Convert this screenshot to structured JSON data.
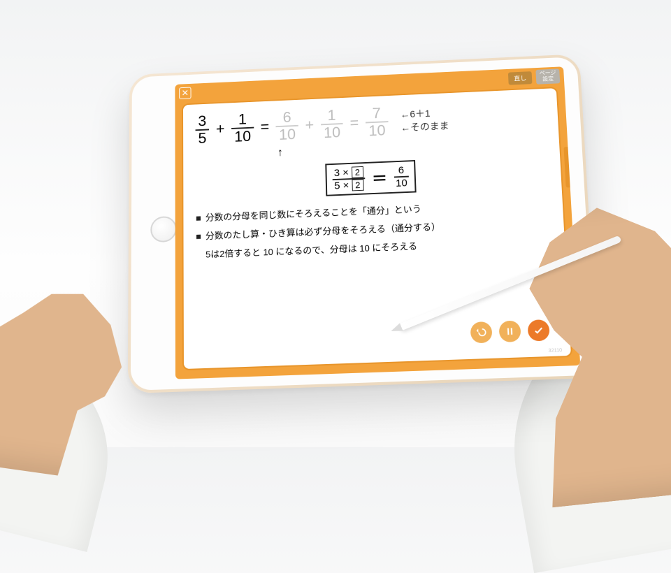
{
  "topbar": {
    "undo_label": "直し",
    "page_settings_label": "ページ\n設定"
  },
  "equation": {
    "f1": {
      "num": "3",
      "den": "5"
    },
    "plus1": "+",
    "f2": {
      "num": "1",
      "den": "10"
    },
    "eq1": "=",
    "f3": {
      "num": "6",
      "den": "10"
    },
    "plus2": "+",
    "f4": {
      "num": "1",
      "den": "10"
    },
    "eq2": "=",
    "f5": {
      "num": "7",
      "den": "10"
    },
    "note1": "←6＋1",
    "note2": "←そのまま",
    "up_arrow": "↑"
  },
  "boxed": {
    "top_left": "3 ×",
    "top_box": "2",
    "bot_left": "5 ×",
    "bot_box": "2",
    "eq": "＝",
    "right_num": "6",
    "right_den": "10"
  },
  "bullets": {
    "b1": "分数の分母を同じ数にそろえることを「通分」という",
    "b2": "分数のたし算・ひき算は必ず分母をそろえる（通分する）",
    "sub": "5は2倍すると 10 になるので、分母は 10 にそろえる"
  },
  "footer_id": "32110"
}
